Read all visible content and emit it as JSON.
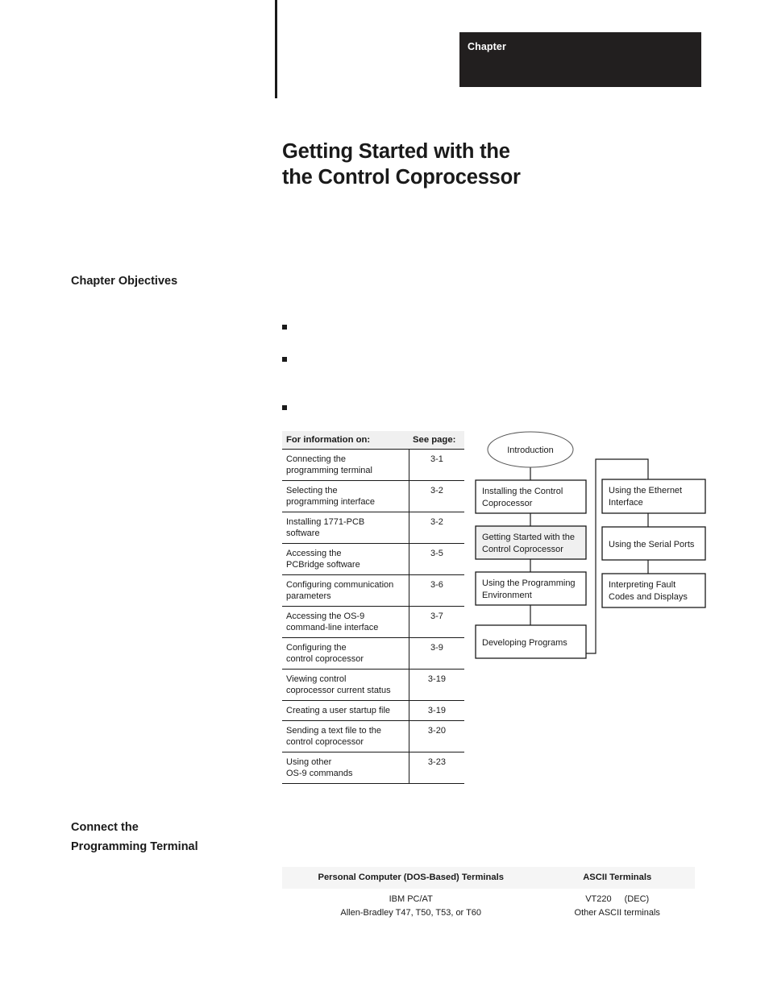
{
  "header": {
    "chapter_label": "Chapter"
  },
  "title": {
    "line1": "Getting Started with the",
    "line2": "the Control Coprocessor"
  },
  "headings": {
    "objectives_line1": "Chapter Objectives",
    "connect_line1": "Connect the",
    "connect_line2": "Programming Terminal"
  },
  "bullets": [
    {
      "marker": "square"
    },
    {
      "marker": "square"
    },
    {
      "marker": "square"
    }
  ],
  "info_table": {
    "columns": [
      "For information on:",
      "See page:"
    ],
    "rows": [
      {
        "topic_line1": "Connecting the",
        "topic_line2": "programming terminal",
        "page": "3-1"
      },
      {
        "topic_line1": "Selecting the",
        "topic_line2": "programming interface",
        "page": "3-2"
      },
      {
        "topic_line1": "Installing 1771-PCB",
        "topic_line2": "software",
        "page": "3-2"
      },
      {
        "topic_line1": "Accessing the",
        "topic_line2": "PCBridge software",
        "page": "3-5"
      },
      {
        "topic_line1": "Configuring communication",
        "topic_line2": "parameters",
        "page": "3-6"
      },
      {
        "topic_line1": "Accessing the OS-9",
        "topic_line2": "command-line interface",
        "page": "3-7"
      },
      {
        "topic_line1": "Configuring the",
        "topic_line2": "control coprocessor",
        "page": "3-9"
      },
      {
        "topic_line1": "Viewing control",
        "topic_line2": "coprocessor current status",
        "page": "3-19"
      },
      {
        "topic_line1": "Creating a user startup file",
        "topic_line2": "",
        "page": "3-19"
      },
      {
        "topic_line1": "Sending a text file to the",
        "topic_line2": "control coprocessor",
        "page": "3-20"
      },
      {
        "topic_line1": "Using other",
        "topic_line2": "OS-9 commands",
        "page": "3-23"
      }
    ]
  },
  "flowchart": {
    "start": {
      "label": "Introduction"
    },
    "left_column": [
      {
        "id": "installing",
        "line1": "Installing the Control",
        "line2": "Coprocessor",
        "highlighted": false
      },
      {
        "id": "getting-started",
        "line1": "Getting Started with the",
        "line2": "Control Coprocessor",
        "highlighted": true
      },
      {
        "id": "programming-env",
        "line1": "Using the Programming",
        "line2": "Environment",
        "highlighted": false
      },
      {
        "id": "developing",
        "line1": "Developing Programs",
        "line2": "",
        "highlighted": false
      }
    ],
    "right_column": [
      {
        "id": "ethernet",
        "line1": "Using the Ethernet",
        "line2": "Interface"
      },
      {
        "id": "serial-ports",
        "line1": "Using the Serial Ports",
        "line2": ""
      },
      {
        "id": "fault-codes",
        "line1": "Interpreting Fault",
        "line2": "Codes and Displays"
      }
    ],
    "highlight_color": "#f0f0f0"
  },
  "terminals_table": {
    "columns": [
      "Personal Computer (DOS-Based) Terminals",
      "ASCII Terminals"
    ],
    "rows": [
      {
        "pc_line1": "IBM PC/AT",
        "pc_line2": "Allen-Bradley T47, T50, T53, or T60",
        "ascii_line1_a": "VT220",
        "ascii_line1_b": "(DEC)",
        "ascii_line2": "Other ASCII terminals"
      }
    ]
  }
}
